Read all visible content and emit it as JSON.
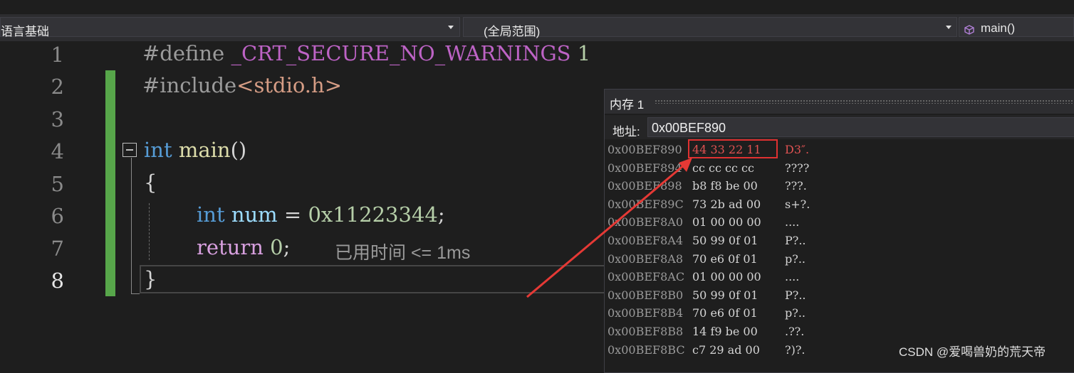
{
  "navbar": {
    "project": "语言基础",
    "scope": "(全局范围)",
    "member": "main()"
  },
  "editor": {
    "lines": [
      {
        "n": "1"
      },
      {
        "n": "2"
      },
      {
        "n": "3"
      },
      {
        "n": "4"
      },
      {
        "n": "5"
      },
      {
        "n": "6"
      },
      {
        "n": "7"
      },
      {
        "n": "8"
      }
    ],
    "code": {
      "l1_directive": "#define",
      "l1_macro": "_CRT_SECURE_NO_WARNINGS",
      "l1_value": "1",
      "l2_directive": "#include",
      "l2_header": "<stdio.h>",
      "l4_type": "int",
      "l4_func": "main",
      "l4_parens": "()",
      "l5_brace": "{",
      "l6_type": "int",
      "l6_var": "num",
      "l6_eq": "=",
      "l6_value": "0x11223344",
      "l6_semi": ";",
      "l7_kw": "return",
      "l7_value": "0",
      "l7_semi": ";",
      "l8_brace": "}"
    },
    "perf_tip": "已用时间 <= 1ms"
  },
  "memory": {
    "title": "内存 1",
    "address_label": "地址:",
    "address_value": "0x00BEF890",
    "rows": [
      {
        "addr": "0x00BEF890",
        "bytes": "44 33 22 11",
        "chars": "D3″."
      },
      {
        "addr": "0x00BEF894",
        "bytes": "cc cc cc cc",
        "chars": "????"
      },
      {
        "addr": "0x00BEF898",
        "bytes": "b8 f8 be 00",
        "chars": "???."
      },
      {
        "addr": "0x00BEF89C",
        "bytes": "73 2b ad 00",
        "chars": "s+?."
      },
      {
        "addr": "0x00BEF8A0",
        "bytes": "01 00 00 00",
        "chars": "...."
      },
      {
        "addr": "0x00BEF8A4",
        "bytes": "50 99 0f 01",
        "chars": "P?.."
      },
      {
        "addr": "0x00BEF8A8",
        "bytes": "70 e6 0f 01",
        "chars": "p?.."
      },
      {
        "addr": "0x00BEF8AC",
        "bytes": "01 00 00 00",
        "chars": "...."
      },
      {
        "addr": "0x00BEF8B0",
        "bytes": "50 99 0f 01",
        "chars": "P?.."
      },
      {
        "addr": "0x00BEF8B4",
        "bytes": "70 e6 0f 01",
        "chars": "p?.."
      },
      {
        "addr": "0x00BEF8B8",
        "bytes": "14 f9 be 00",
        "chars": ".??."
      },
      {
        "addr": "0x00BEF8BC",
        "bytes": "c7 29 ad 00",
        "chars": "?)?."
      }
    ]
  },
  "watermark": "CSDN @爱喝兽奶的荒天帝",
  "colors": {
    "background": "#1e1e1e",
    "change_bar": "#57a64a",
    "highlight": "#e03131"
  }
}
